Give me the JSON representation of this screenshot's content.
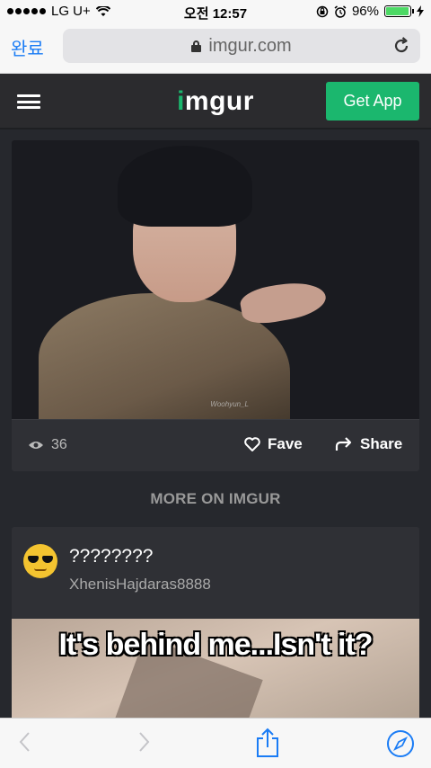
{
  "status_bar": {
    "carrier": "LG U+",
    "time": "오전 12:57",
    "battery_percent": "96%",
    "battery_level": 0.96
  },
  "browser": {
    "done_label": "완료",
    "url": "imgur.com",
    "accent_color": "#1a7cf5"
  },
  "imgur": {
    "logo_text": "imgur",
    "get_app_label": "Get App",
    "brand_color": "#1bb76e"
  },
  "post": {
    "watermark": "Woohyun_L",
    "views": "36",
    "fave_label": "Fave",
    "share_label": "Share"
  },
  "more_label": "MORE ON IMGUR",
  "post2": {
    "title": "????????",
    "username": "XhenisHajdaras8888",
    "meme_caption": "It's behind me...Isn't it?"
  }
}
